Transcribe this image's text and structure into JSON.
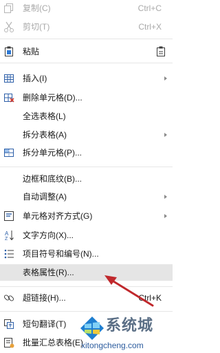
{
  "menu": {
    "copy": {
      "label": "复制(C)",
      "shortcut": "Ctrl+C"
    },
    "cut": {
      "label": "剪切(T)",
      "shortcut": "Ctrl+X"
    },
    "paste": {
      "label": "粘贴"
    },
    "insert": {
      "label": "插入(I)"
    },
    "delete_cells": {
      "label": "删除单元格(D)..."
    },
    "select_table": {
      "label": "全选表格(L)"
    },
    "split_table": {
      "label": "拆分表格(A)"
    },
    "split_cells": {
      "label": "拆分单元格(P)..."
    },
    "borders_shading": {
      "label": "边框和底纹(B)..."
    },
    "autofit": {
      "label": "自动调整(A)"
    },
    "cell_alignment": {
      "label": "单元格对齐方式(G)"
    },
    "text_direction": {
      "label": "文字方向(X)..."
    },
    "bullets_numbering": {
      "label": "项目符号和编号(N)..."
    },
    "table_properties": {
      "label": "表格属性(R)..."
    },
    "hyperlink": {
      "label": "超链接(H)...",
      "shortcut": "Ctrl+K"
    },
    "short_translate": {
      "label": "短句翻译(T)"
    },
    "batch_summary": {
      "label": "批量汇总表格(E)"
    }
  },
  "watermark": {
    "brand": "系统城",
    "url": "xitongcheng.com"
  },
  "colors": {
    "highlight": "#e5e5e5",
    "arrow": "#c0282c",
    "disabled": "#a9a9a9"
  }
}
